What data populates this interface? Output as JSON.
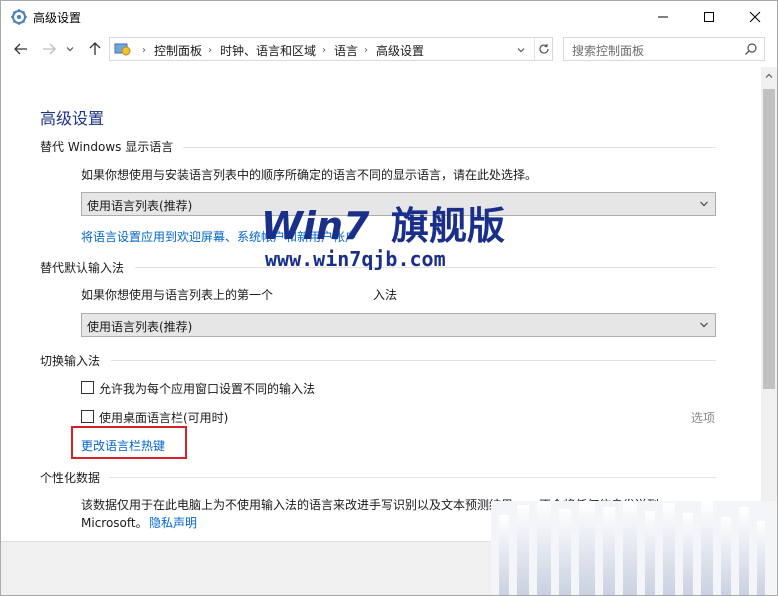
{
  "window": {
    "title": "高级设置"
  },
  "nav": {
    "breadcrumb": [
      "控制面板",
      "时钟、语言和区域",
      "语言",
      "高级设置"
    ],
    "search_placeholder": "搜索控制面板"
  },
  "page": {
    "title": "高级设置",
    "display_language": {
      "heading": "替代 Windows 显示语言",
      "description": "如果你想使用与安装语言列表中的顺序所确定的语言不同的显示语言，请在此处选择。",
      "select_value": "使用语言列表(推荐)",
      "link": "将语言设置应用到欢迎屏幕、系统帐户和新用户帐户"
    },
    "input_method": {
      "heading": "替代默认输入法",
      "description": "如果你想使用与语言列表上的第一个",
      "description_tail": "入法",
      "select_value": "使用语言列表(推荐)"
    },
    "switch_input": {
      "heading": "切换输入法",
      "checkbox1_label": "允许我为每个应用窗口设置不同的输入法",
      "checkbox2_label": "使用桌面语言栏(可用时)",
      "options_link": "选项",
      "hotkey_link": "更改语言栏热键"
    },
    "personalization": {
      "heading": "个性化数据",
      "description": "该数据仅用于在此电脑上为不使用输入法的语言来改进手写识别以及文本预测结果。",
      "description_tail": "不会将任何信息发送到",
      "company": "Microsoft。",
      "privacy_link": "隐私声明"
    }
  },
  "watermark": {
    "brand": "Win7",
    "brand_cn": "旗舰版",
    "url": "www.win7qjb.com"
  },
  "colors": {
    "title_blue": "#1e3287",
    "link_blue": "#0066cc",
    "highlight_red": "#d9202a",
    "watermark_blue": "#1a2f8a"
  }
}
